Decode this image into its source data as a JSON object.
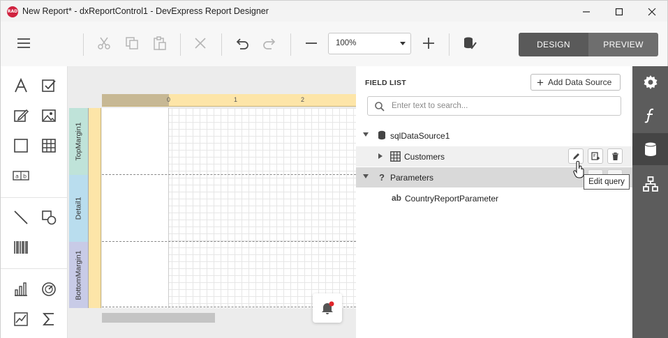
{
  "window": {
    "logo_text": "RAD",
    "title": "New Report* - dxReportControl1 - DevExpress Report Designer"
  },
  "toolbar": {
    "zoom_value": "100%",
    "design_label": "DESIGN",
    "preview_label": "PREVIEW",
    "active_mode": "DESIGN"
  },
  "design_surface": {
    "ruler_numbers": [
      "0",
      "1",
      "2"
    ],
    "bands": [
      "TopMargin1",
      "Detail1",
      "BottomMargin1"
    ]
  },
  "field_list": {
    "title": "FIELD LIST",
    "add_data_source_label": "Add Data Source",
    "search_placeholder": "Enter text to search...",
    "tree": {
      "data_source": "sqlDataSource1",
      "table": "Customers",
      "parameters_group": "Parameters",
      "parameter": "CountryReportParameter",
      "parameter_type_glyph": "ab",
      "parameters_glyph": "?"
    },
    "tooltip": "Edit query"
  },
  "colors": {
    "accent_dark": "#5a5a5a",
    "side_strip": "#5c5c5c",
    "band_top": "#bfe3d9",
    "band_detail": "#b9ddee",
    "band_bottom": "#c8cbe7",
    "ruler": "#fde5a8",
    "hover_row": "#f0f0f0",
    "selected_row": "#d9d9d9"
  }
}
